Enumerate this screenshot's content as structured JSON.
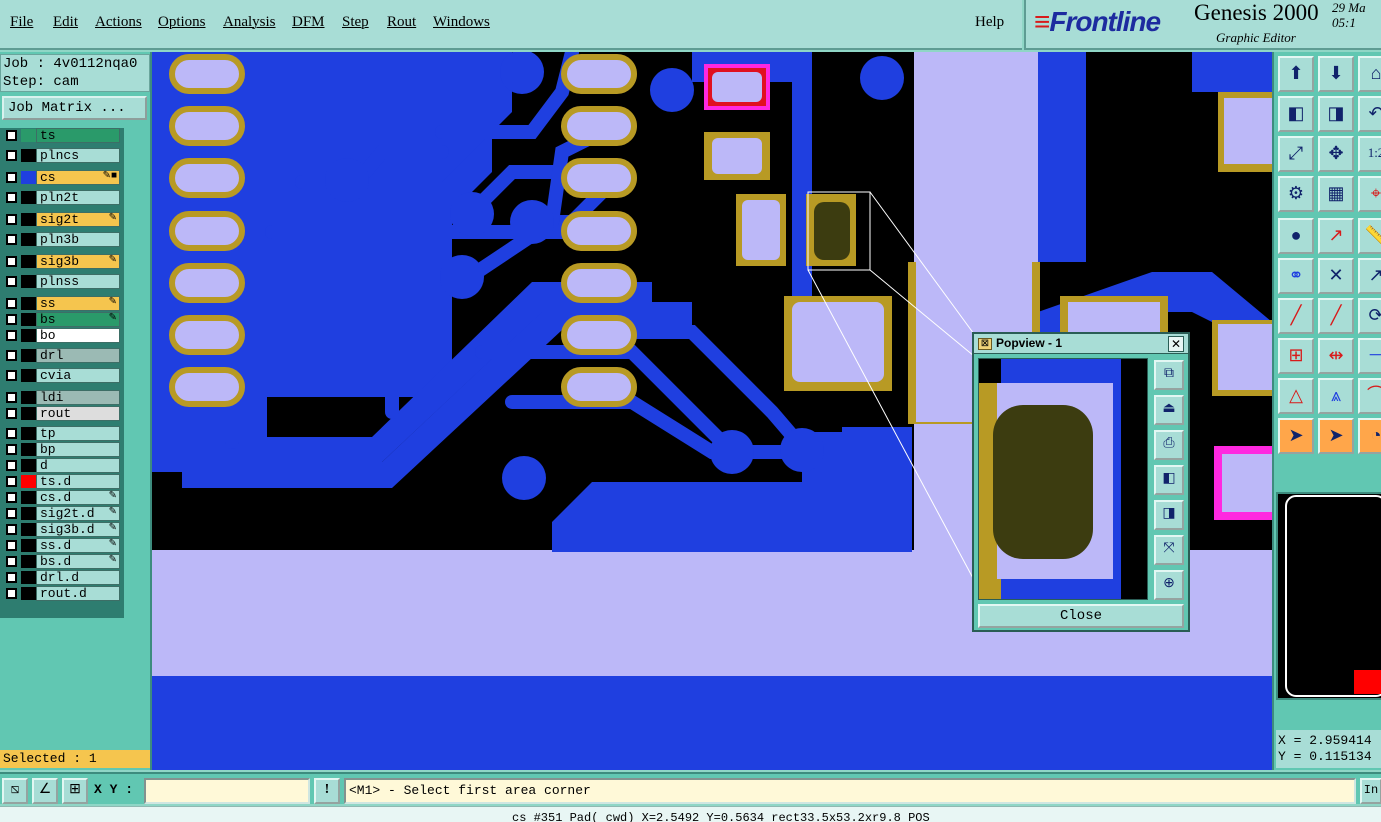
{
  "menu": {
    "items": [
      "File",
      "Edit",
      "Actions",
      "Options",
      "Analysis",
      "DFM",
      "Step",
      "Rout",
      "Windows"
    ],
    "help": "Help"
  },
  "brand": {
    "logo": "Frontline",
    "product": "Genesis 2000",
    "subtitle": "Graphic Editor",
    "date": "29 Ma",
    "time": "05:1"
  },
  "job": {
    "job_line": "Job : 4v0112nqa0",
    "step_line": "Step: cam",
    "matrix_button": "Job Matrix ..."
  },
  "layers": [
    {
      "name": "ts",
      "color": "#2a9a6a",
      "swatch": "#2a9a6a",
      "flag": ""
    },
    {
      "name": "plncs",
      "color": "#a8ddd6",
      "swatch": "#000000",
      "flag": ""
    },
    {
      "name": "cs",
      "color": "#f5c54e",
      "swatch": "#1f3fe0",
      "flag": "✎■"
    },
    {
      "name": "pln2t",
      "color": "#a8ddd6",
      "swatch": "#000000",
      "flag": ""
    },
    {
      "name": "sig2t",
      "color": "#f5c54e",
      "swatch": "#000000",
      "flag": "✎"
    },
    {
      "name": "pln3b",
      "color": "#a8ddd6",
      "swatch": "#000000",
      "flag": ""
    },
    {
      "name": "sig3b",
      "color": "#f5c54e",
      "swatch": "#000000",
      "flag": "✎"
    },
    {
      "name": "plnss",
      "color": "#a8ddd6",
      "swatch": "#000000",
      "flag": ""
    },
    {
      "name": "ss",
      "color": "#f5c54e",
      "swatch": "#000000",
      "flag": "✎"
    },
    {
      "name": "bs",
      "color": "#2a9a6a",
      "swatch": "#000000",
      "flag": "✎"
    },
    {
      "name": "bo",
      "color": "#ffffff",
      "swatch": "#000000",
      "flag": ""
    },
    {
      "name": "drl",
      "color": "#9bbab4",
      "swatch": "#000000",
      "flag": ""
    },
    {
      "name": "cvia",
      "color": "#a8ddd6",
      "swatch": "#000000",
      "flag": ""
    },
    {
      "name": "ldi",
      "color": "#9bbab4",
      "swatch": "#000000",
      "flag": ""
    },
    {
      "name": "rout",
      "color": "#dddddd",
      "swatch": "#000000",
      "flag": ""
    },
    {
      "name": "tp",
      "color": "#a8ddd6",
      "swatch": "#000000",
      "flag": ""
    },
    {
      "name": "bp",
      "color": "#a8ddd6",
      "swatch": "#000000",
      "flag": ""
    },
    {
      "name": "d",
      "color": "#a8ddd6",
      "swatch": "#000000",
      "flag": ""
    },
    {
      "name": "ts.d",
      "color": "#a8ddd6",
      "swatch": "#ff0000",
      "flag": ""
    },
    {
      "name": "cs.d",
      "color": "#a8ddd6",
      "swatch": "#000000",
      "flag": "✎"
    },
    {
      "name": "sig2t.d",
      "color": "#a8ddd6",
      "swatch": "#000000",
      "flag": "✎"
    },
    {
      "name": "sig3b.d",
      "color": "#a8ddd6",
      "swatch": "#000000",
      "flag": "✎"
    },
    {
      "name": "ss.d",
      "color": "#a8ddd6",
      "swatch": "#000000",
      "flag": "✎"
    },
    {
      "name": "bs.d",
      "color": "#a8ddd6",
      "swatch": "#000000",
      "flag": "✎"
    },
    {
      "name": "drl.d",
      "color": "#a8ddd6",
      "swatch": "#000000",
      "flag": ""
    },
    {
      "name": "rout.d",
      "color": "#a8ddd6",
      "swatch": "#000000",
      "flag": ""
    }
  ],
  "selected_text": "Selected : 1",
  "popview": {
    "title": "Popview - 1",
    "close_label": "Close",
    "close_x": "✕"
  },
  "readout": {
    "x": "X = 2.959414",
    "y": "Y = 0.115134"
  },
  "command": {
    "xy_label": "X Y :",
    "xy_value": "",
    "prompt": "<M1> - Select first area corner",
    "right_button": "In"
  },
  "status_line": "cs #351 Pad( cwd) X=2.5492 Y=0.5634 rect33.5x53.2xr9.8 POS",
  "colors": {
    "copper": "#1f3fe0",
    "plane": "#bcb8f8",
    "pad_ring": "#b89a24",
    "pad_fill": "#bcb8f8",
    "highlight": "#ff28e0",
    "selected_pad": "#3c3c10",
    "accent_orange": "#ffa64a"
  },
  "toolbar_icons": [
    "zoom-in-icon",
    "zoom-out-icon",
    "undo-icon",
    "zoom-fit-icon",
    "pan-icon",
    "scale-icon",
    "measure-icon",
    "grid-icon",
    "snap-icon",
    "select-icon",
    "move-icon",
    "delete-icon",
    "rotate-icon",
    "add-icon",
    "mirror-icon",
    "arc-icon",
    "pointer-icon"
  ]
}
